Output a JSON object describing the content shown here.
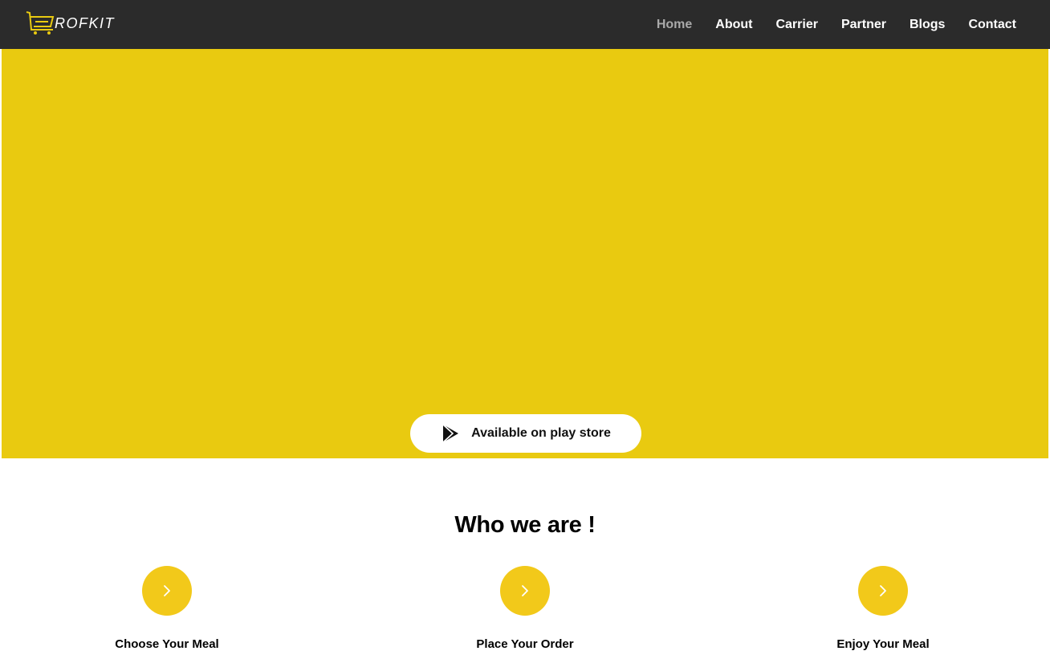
{
  "brand": {
    "logo_icon": "cart-icon",
    "accent_color": "#e9ca10"
  },
  "nav": {
    "items": [
      {
        "label": "Home",
        "active": true
      },
      {
        "label": "About",
        "active": false
      },
      {
        "label": "Carrier",
        "active": false
      },
      {
        "label": "Partner",
        "active": false
      },
      {
        "label": "Blogs",
        "active": false
      },
      {
        "label": "Contact",
        "active": false
      }
    ]
  },
  "hero": {
    "play_store_label": "Available on play store",
    "play_store_icon": "google-play-icon"
  },
  "who_we_are": {
    "title": "Who we are !",
    "steps": [
      {
        "label": "Choose Your Meal",
        "icon": "chevron-right-icon"
      },
      {
        "label": "Place Your Order",
        "icon": "chevron-right-icon"
      },
      {
        "label": "Enjoy Your Meal",
        "icon": "chevron-right-icon"
      }
    ]
  }
}
